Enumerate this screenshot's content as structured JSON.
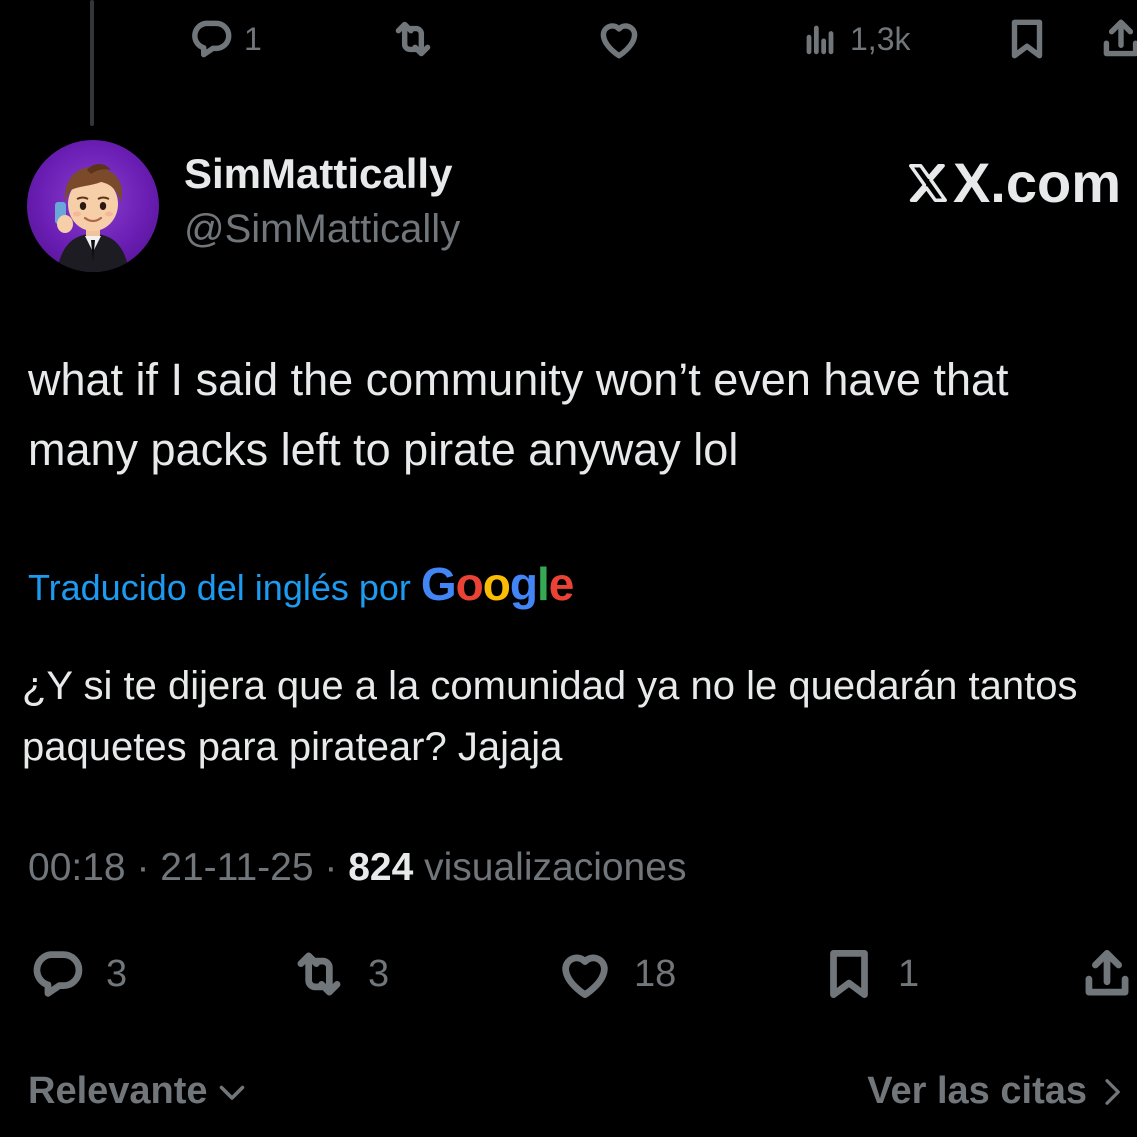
{
  "previous_tweet": {
    "replies": "1",
    "views": "1,3k"
  },
  "author": {
    "display_name": "SimMattically",
    "handle": "@SimMattically"
  },
  "watermark": "X.com",
  "tweet": {
    "text": "what if I said the community won’t even have that many packs left to pirate anyway lol",
    "translated_by": "Traducido del inglés por",
    "translator_logo": "Google",
    "translation": "¿Y si te dijera que a la comunidad ya no le quedarán tantos paquetes para piratear? Jajaja",
    "time": "00:18",
    "date": "21-11-25",
    "view_count": "824",
    "views_label": "visualizaciones",
    "separator": "·"
  },
  "actions": {
    "replies": "3",
    "reposts": "3",
    "likes": "18",
    "bookmarks": "1"
  },
  "footer": {
    "sort_label": "Relevante",
    "quotes_label": "Ver las citas"
  },
  "colors": {
    "background": "#000000",
    "text": "#e7e9ea",
    "muted": "#71767b",
    "link": "#1d9bf0",
    "google_blue": "#4285f4",
    "google_red": "#ea4335",
    "google_yellow": "#fbbc05",
    "google_green": "#34a853"
  },
  "icons": [
    "reply-icon",
    "repost-icon",
    "like-icon",
    "views-icon",
    "bookmark-icon",
    "share-icon",
    "x-logo-icon",
    "chevron-down-icon",
    "chevron-right-icon"
  ]
}
